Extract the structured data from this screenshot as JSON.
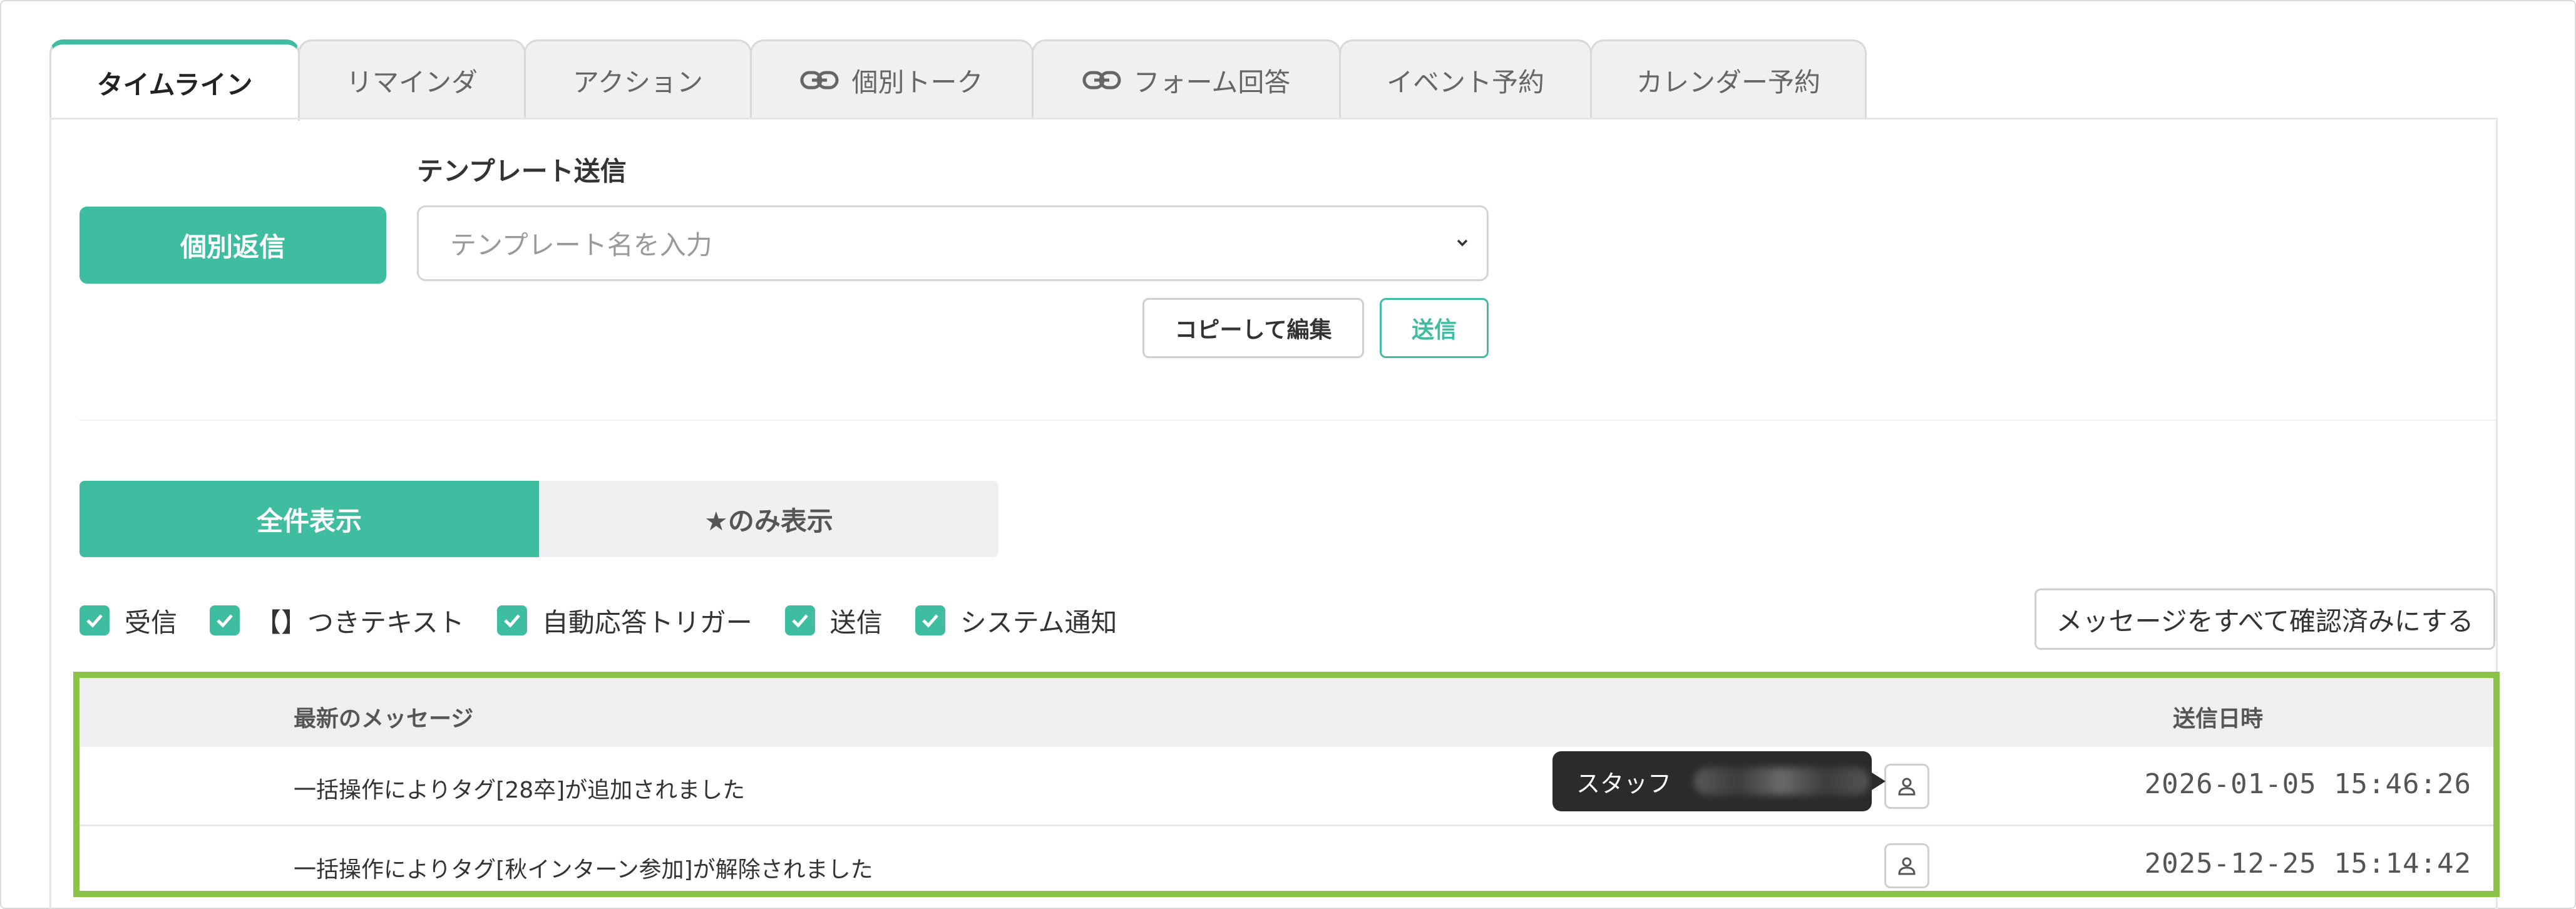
{
  "tabs": [
    {
      "label": "タイムライン",
      "active": true,
      "icon": ""
    },
    {
      "label": "リマインダ",
      "active": false,
      "icon": ""
    },
    {
      "label": "アクション",
      "active": false,
      "icon": ""
    },
    {
      "label": "個別トーク",
      "active": false,
      "icon": "link-icon"
    },
    {
      "label": "フォーム回答",
      "active": false,
      "icon": "link-icon"
    },
    {
      "label": "イベント予約",
      "active": false,
      "icon": ""
    },
    {
      "label": "カレンダー予約",
      "active": false,
      "icon": ""
    }
  ],
  "reply": {
    "button_label": "個別返信"
  },
  "template": {
    "label": "テンプレート送信",
    "placeholder": "テンプレート名を入力",
    "copy_edit_label": "コピーして編集",
    "send_label": "送信"
  },
  "view_toggle": {
    "all_label": "全件表示",
    "starred_label": "★のみ表示",
    "selected": "all"
  },
  "filters": [
    {
      "label": "受信",
      "checked": true
    },
    {
      "label": "【】つきテキスト",
      "checked": true
    },
    {
      "label": "自動応答トリガー",
      "checked": true
    },
    {
      "label": "送信",
      "checked": true
    },
    {
      "label": "システム通知",
      "checked": true
    }
  ],
  "mark_all_read_label": "メッセージをすべて確認済みにする",
  "table": {
    "headers": {
      "message": "最新のメッセージ",
      "sent_at": "送信日時"
    },
    "rows": [
      {
        "message": "一括操作によりタグ[28卒]が追加されました",
        "sent_at": "2026-01-05 15:46:26"
      },
      {
        "message": "一括操作によりタグ[秋インターン参加]が解除されました",
        "sent_at": "2025-12-25 15:14:42"
      }
    ]
  },
  "tooltip": {
    "prefix": "スタッフ"
  },
  "colors": {
    "accent": "#3fbda0",
    "highlight_border": "#8bc34a",
    "tooltip_bg": "#2b2b2b"
  }
}
